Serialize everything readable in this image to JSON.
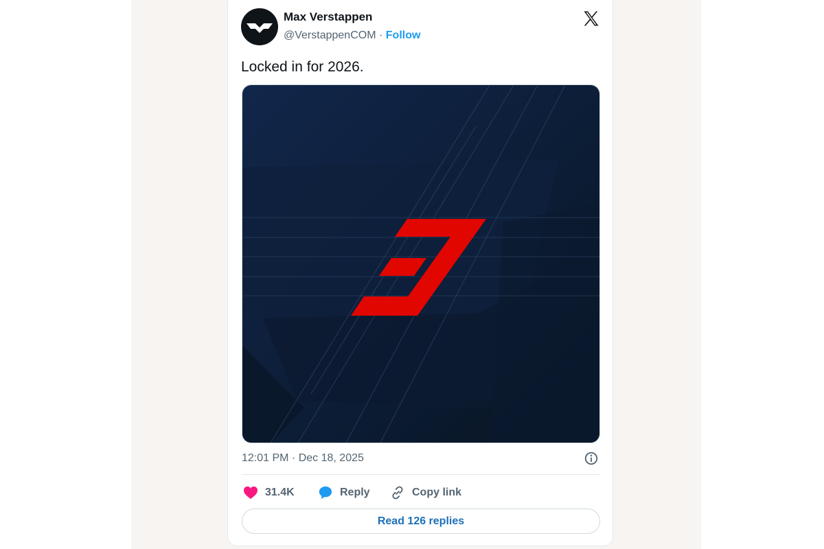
{
  "author": {
    "name": "Max Verstappen",
    "handle": "@VerstappenCOM",
    "separator": "·",
    "follow_label": "Follow"
  },
  "tweet": {
    "text": "Locked in for 2026.",
    "timestamp": "12:01 PM · Dec 18, 2025",
    "media_icon": "number-3-graphic"
  },
  "actions": {
    "likes": "31.4K",
    "reply_label": "Reply",
    "copy_link_label": "Copy link",
    "read_replies_label": "Read 126 replies"
  },
  "icons": {
    "logo": "x-logo-icon",
    "info": "info-icon",
    "like": "heart-icon",
    "reply": "speech-bubble-icon",
    "copy": "link-icon"
  },
  "colors": {
    "link": "#1d9bf0",
    "like": "#f91880",
    "number": "#e10600",
    "media_bg": "#0d1e33"
  }
}
